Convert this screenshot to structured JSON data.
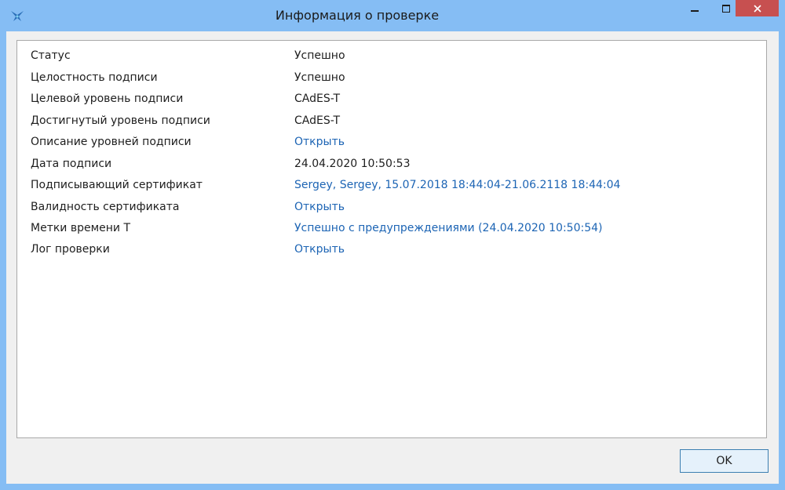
{
  "window": {
    "title": "Информация о проверке"
  },
  "titlebar_buttons": {
    "minimize_icon": "minimize-icon",
    "maximize_icon": "maximize-icon",
    "close_icon": "close-icon",
    "close_color": "#c75050"
  },
  "details": {
    "rows": [
      {
        "label": "Статус",
        "value": "Успешно",
        "link": false
      },
      {
        "label": "Целостность подписи",
        "value": "Успешно",
        "link": false
      },
      {
        "label": "Целевой уровень подписи",
        "value": "CAdES-T",
        "link": false
      },
      {
        "label": "Достигнутый уровень подписи",
        "value": "CAdES-T",
        "link": false
      },
      {
        "label": "Описание уровней подписи",
        "value": "Открыть",
        "link": true
      },
      {
        "label": "Дата подписи",
        "value": "24.04.2020 10:50:53",
        "link": false
      },
      {
        "label": "Подписывающий сертификат",
        "value": "Sergey, Sergey, 15.07.2018 18:44:04-21.06.2118 18:44:04",
        "link": true
      },
      {
        "label": "Валидность сертификата",
        "value": "Открыть",
        "link": true
      },
      {
        "label": "Метки времени Т",
        "value": "Успешно с предупреждениями (24.04.2020 10:50:54)",
        "link": true
      },
      {
        "label": "Лог проверки",
        "value": "Открыть",
        "link": true
      }
    ]
  },
  "footer": {
    "ok_label": "OK"
  },
  "colors": {
    "frame": "#85bdf4",
    "link": "#1c64b4",
    "client_bg": "#f0f0f0"
  }
}
